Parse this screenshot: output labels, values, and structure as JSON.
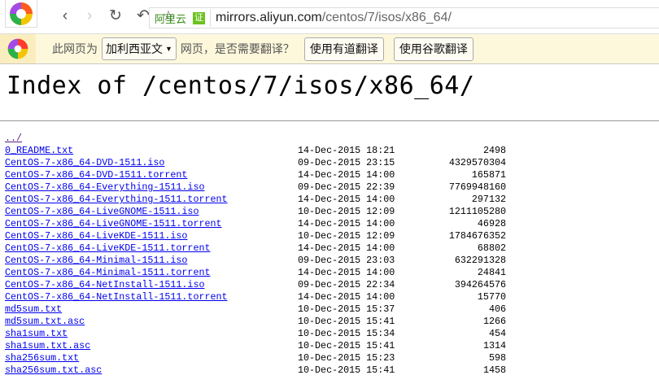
{
  "browser": {
    "address": {
      "site_label": "阿里云",
      "cert_label": "证",
      "host": "mirrors.aliyun.com",
      "path": "/centos/7/isos/x86_64/"
    }
  },
  "translate_bar": {
    "prefix": "此网页为",
    "language": "加利西亚文",
    "suffix": "网页，是否需要翻译？",
    "youdao_button": "使用有道翻译",
    "google_button": "使用谷歌翻译"
  },
  "page": {
    "title": "Index of /centos/7/isos/x86_64/",
    "parent_link": "../",
    "files": [
      {
        "name": "0_README.txt",
        "date": "14-Dec-2015 18:21",
        "size": "2498"
      },
      {
        "name": "CentOS-7-x86_64-DVD-1511.iso",
        "date": "09-Dec-2015 23:15",
        "size": "4329570304"
      },
      {
        "name": "CentOS-7-x86_64-DVD-1511.torrent",
        "date": "14-Dec-2015 14:00",
        "size": "165871"
      },
      {
        "name": "CentOS-7-x86_64-Everything-1511.iso",
        "date": "09-Dec-2015 22:39",
        "size": "7769948160"
      },
      {
        "name": "CentOS-7-x86_64-Everything-1511.torrent",
        "date": "14-Dec-2015 14:00",
        "size": "297132"
      },
      {
        "name": "CentOS-7-x86_64-LiveGNOME-1511.iso",
        "date": "10-Dec-2015 12:09",
        "size": "1211105280"
      },
      {
        "name": "CentOS-7-x86_64-LiveGNOME-1511.torrent",
        "date": "14-Dec-2015 14:00",
        "size": "46928"
      },
      {
        "name": "CentOS-7-x86_64-LiveKDE-1511.iso",
        "date": "10-Dec-2015 12:09",
        "size": "1784676352"
      },
      {
        "name": "CentOS-7-x86_64-LiveKDE-1511.torrent",
        "date": "14-Dec-2015 14:00",
        "size": "68802"
      },
      {
        "name": "CentOS-7-x86_64-Minimal-1511.iso",
        "date": "09-Dec-2015 23:03",
        "size": "632291328"
      },
      {
        "name": "CentOS-7-x86_64-Minimal-1511.torrent",
        "date": "14-Dec-2015 14:00",
        "size": "24841"
      },
      {
        "name": "CentOS-7-x86_64-NetInstall-1511.iso",
        "date": "09-Dec-2015 22:34",
        "size": "394264576"
      },
      {
        "name": "CentOS-7-x86_64-NetInstall-1511.torrent",
        "date": "14-Dec-2015 14:00",
        "size": "15770"
      },
      {
        "name": "md5sum.txt",
        "date": "10-Dec-2015 15:37",
        "size": "406"
      },
      {
        "name": "md5sum.txt.asc",
        "date": "10-Dec-2015 15:41",
        "size": "1266"
      },
      {
        "name": "sha1sum.txt",
        "date": "10-Dec-2015 15:34",
        "size": "454"
      },
      {
        "name": "sha1sum.txt.asc",
        "date": "10-Dec-2015 15:41",
        "size": "1314"
      },
      {
        "name": "sha256sum.txt",
        "date": "10-Dec-2015 15:23",
        "size": "598"
      },
      {
        "name": "sha256sum.txt.asc",
        "date": "10-Dec-2015 15:41",
        "size": "1458"
      }
    ]
  }
}
